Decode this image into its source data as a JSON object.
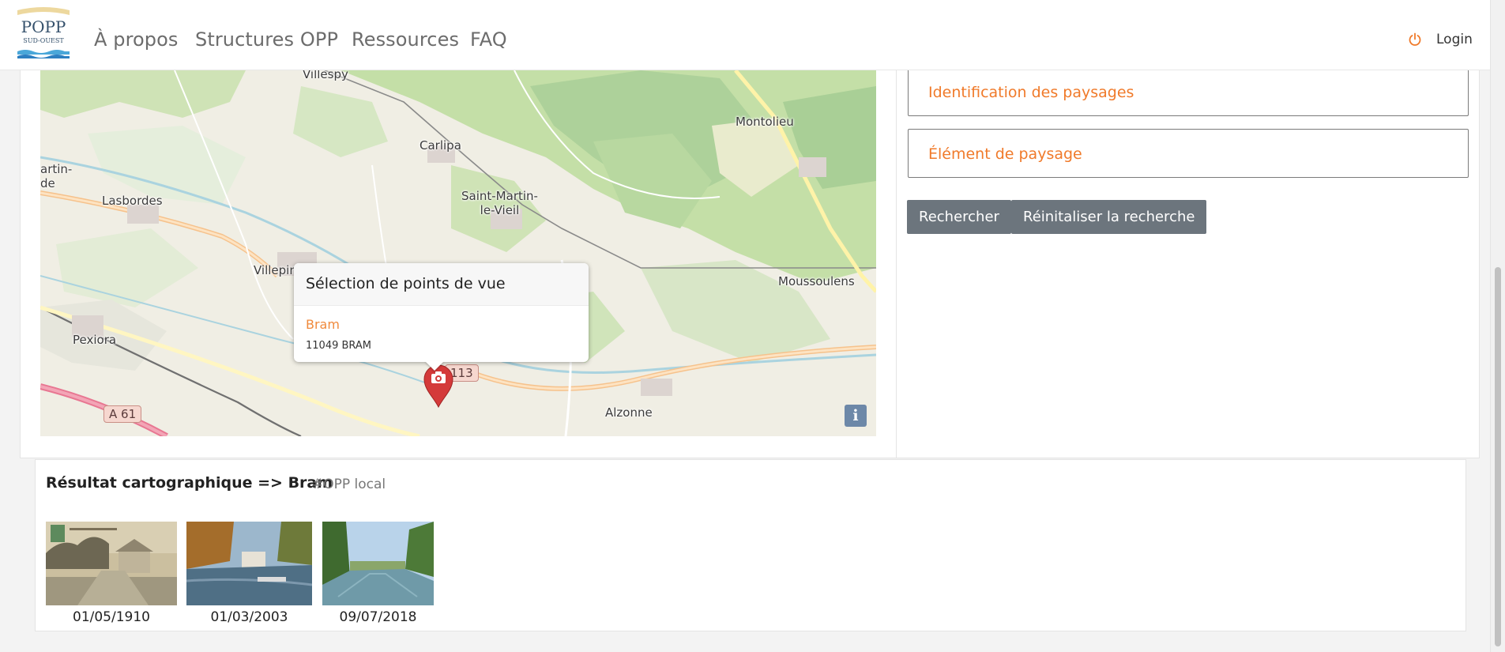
{
  "navbar": {
    "logo": {
      "text_top": "POPP",
      "text_bottom": "SUD-OUEST"
    },
    "links": [
      "À propos",
      "Structures OPP",
      "Ressources",
      "FAQ"
    ],
    "login_label": "Login"
  },
  "map": {
    "places": {
      "villespy": "Villespy",
      "carlipa": "Carlipa",
      "montolieu": "Montolieu",
      "martin_de": "artin-\nde",
      "lasbordes": "Lasbordes",
      "saint_martin": "Saint-Martin-\nle-Vieil",
      "villepin": "Villepin",
      "moussoulens": "Moussoulens",
      "pexiora": "Pexiora",
      "alzonne": "Alzonne"
    },
    "road_d": "113",
    "road_a": "A 61",
    "info_label": "i",
    "popup": {
      "title": "Sélection de points de vue",
      "link": "Bram",
      "subtitle": "11049 BRAM"
    }
  },
  "filters": {
    "identification": "Identification des paysages",
    "element": "Élément de paysage"
  },
  "buttons": {
    "search": "Rechercher",
    "reset": "Réinitaliser la recherche"
  },
  "results": {
    "title": "Résultat cartographique => Bram",
    "tag": "#OPP local",
    "photos": [
      {
        "date": "01/05/1910"
      },
      {
        "date": "01/03/2003"
      },
      {
        "date": "09/07/2018"
      }
    ]
  },
  "colors": {
    "accent": "#f07a2a",
    "button": "#6c757d",
    "marker": "#d43a3a"
  }
}
